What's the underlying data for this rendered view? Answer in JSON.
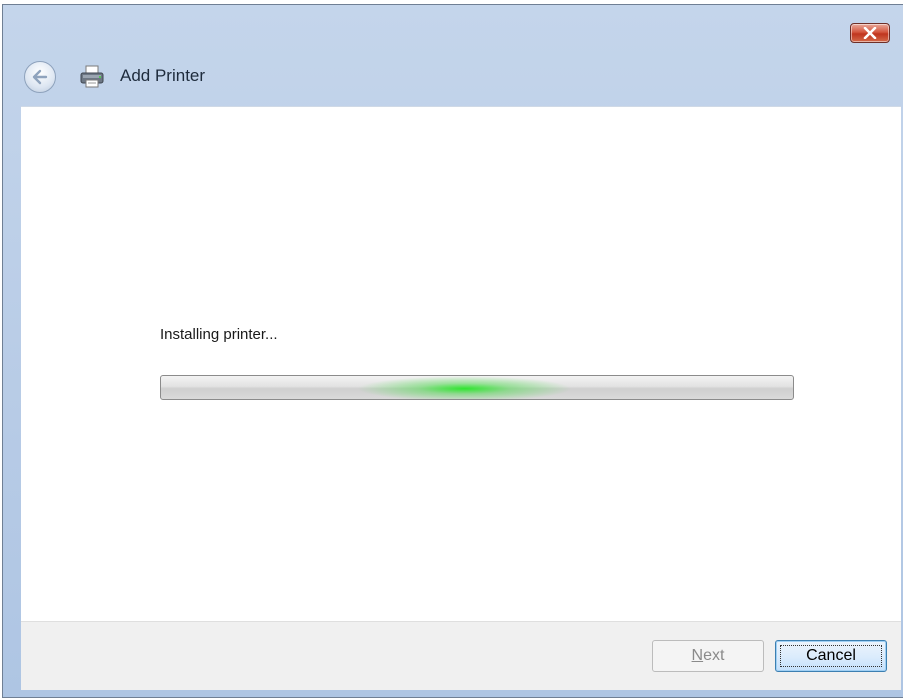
{
  "window": {
    "title": "Add Printer",
    "close_icon": "close-icon",
    "back_icon": "back-arrow-icon",
    "app_icon": "printer-icon"
  },
  "status": {
    "text": "Installing printer..."
  },
  "progress": {
    "mode": "indeterminate",
    "glow_position": 0.48,
    "accent_color": "#25d425"
  },
  "buttons": {
    "next": {
      "mnemonic": "N",
      "rest": "ext",
      "enabled": false
    },
    "cancel": {
      "label": "Cancel"
    }
  }
}
